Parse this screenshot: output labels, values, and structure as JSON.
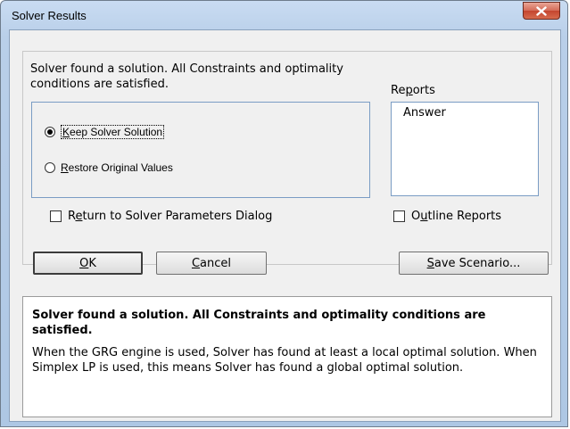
{
  "window": {
    "title": "Solver Results"
  },
  "status": {
    "line1": "Solver found a solution.  All Constraints and optimality",
    "line2": "conditions are satisfied."
  },
  "options": {
    "keep_pre": "",
    "keep_key": "K",
    "keep_post": "eep Solver Solution",
    "restore_pre": "",
    "restore_key": "R",
    "restore_post": "estore Original Values",
    "selected": "keep"
  },
  "reports": {
    "label_pre": "Re",
    "label_key": "p",
    "label_post": "orts",
    "items": [
      "Answer"
    ]
  },
  "checkboxes": {
    "return_pre": "R",
    "return_key": "e",
    "return_post": "turn to Solver Parameters Dialog",
    "outline_pre": "O",
    "outline_key": "u",
    "outline_post": "tline Reports"
  },
  "buttons": {
    "ok_pre": "",
    "ok_key": "O",
    "ok_post": "K",
    "cancel_pre": "",
    "cancel_key": "C",
    "cancel_post": "ancel",
    "save_pre": "",
    "save_key": "S",
    "save_post": "ave Scenario..."
  },
  "info": {
    "title": "Solver found a solution.  All Constraints and optimality conditions are satisfied.",
    "body": "When the GRG engine is used, Solver has found at least a local optimal solution. When Simplex LP is used, this means Solver has found a global optimal solution."
  },
  "colors": {
    "title_bar": "#b9cfe9",
    "close_button": "#c4452f",
    "dialog_bg": "#f0f0f0"
  }
}
